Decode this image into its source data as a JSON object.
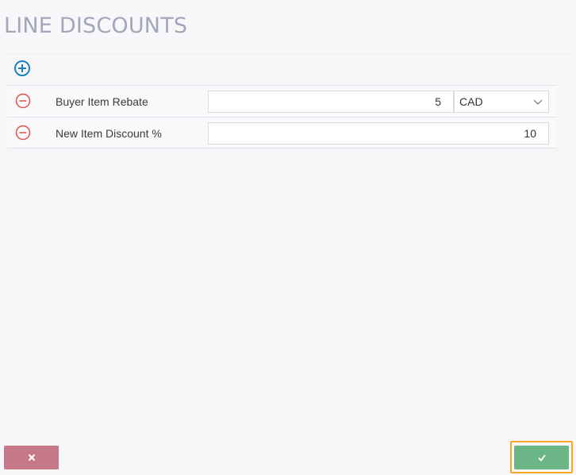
{
  "page": {
    "title": "LINE DISCOUNTS"
  },
  "discounts": [
    {
      "label": "Buyer Item Rebate",
      "value": "5",
      "currency": "CAD"
    },
    {
      "label": "New Item Discount %",
      "value": "10"
    }
  ],
  "icons": {
    "add": "plus-circle-icon",
    "remove": "minus-circle-icon",
    "cancel": "close-icon",
    "confirm": "check-icon",
    "dropdown": "chevron-down-icon"
  },
  "colors": {
    "title": "#a2a6bb",
    "add_icon": "#1a7fc1",
    "remove_icon": "#d9534f",
    "cancel_button": "#c47888",
    "confirm_button": "#6cb587",
    "focus_outline": "#f5a623"
  }
}
